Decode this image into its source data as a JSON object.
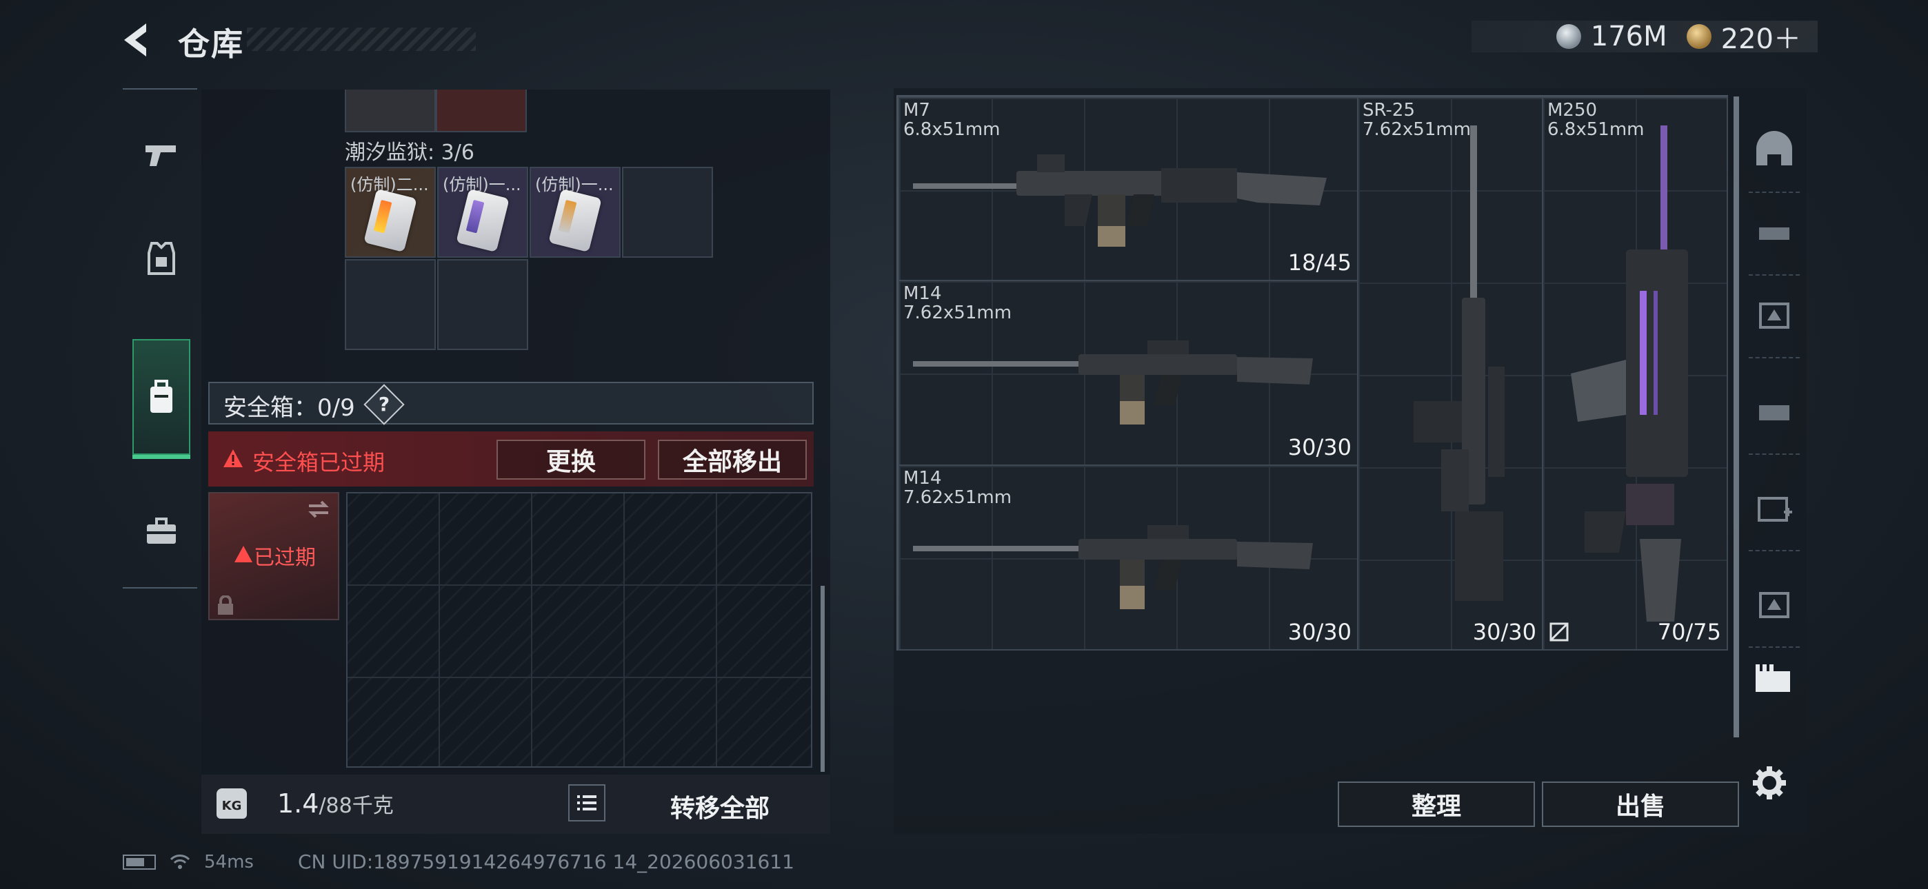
{
  "header": {
    "title": "仓库",
    "currencies": [
      {
        "icon": "silver-coin-icon",
        "value": "176M"
      },
      {
        "icon": "gold-coin-icon",
        "value": "220＋"
      }
    ]
  },
  "rail": {
    "items": [
      {
        "name": "pistol-icon"
      },
      {
        "name": "armor-icon"
      },
      {
        "name": "backpack-icon",
        "active": true
      },
      {
        "name": "toolbox-icon"
      }
    ]
  },
  "storage": {
    "prison_label": "潮汐监狱: 3/6",
    "items": [
      {
        "label": "(仿制)二...",
        "color": "orange"
      },
      {
        "label": "(仿制)一...",
        "color": "purple"
      },
      {
        "label": "(仿制)一...",
        "color": "white"
      }
    ]
  },
  "safebox": {
    "label": "安全箱：0/9",
    "help": "?",
    "expired_text": "安全箱已过期",
    "replace_label": "更换",
    "remove_all_label": "全部移出",
    "slot_status": "已过期"
  },
  "footer_left": {
    "kg_icon": "KG",
    "weight": "1.4",
    "weight_unit": "/88千克",
    "transfer_all": "转移全部"
  },
  "weapons": [
    {
      "name": "M7",
      "caliber": "6.8x51mm",
      "ammo": "18/45"
    },
    {
      "name": "M14",
      "caliber": "7.62x51mm",
      "ammo": "30/30"
    },
    {
      "name": "M14",
      "caliber": "7.62x51mm",
      "ammo": "30/30"
    },
    {
      "name": "SR-25",
      "caliber": "7.62x51mm",
      "ammo": "30/30"
    },
    {
      "name": "M250",
      "caliber": "6.8x51mm",
      "ammo": "70/75"
    }
  ],
  "actions": {
    "sort": "整理",
    "sell": "出售"
  },
  "status": {
    "ping": "54ms",
    "uid": "CN UID:1897591914264976716 14_202606031611"
  }
}
